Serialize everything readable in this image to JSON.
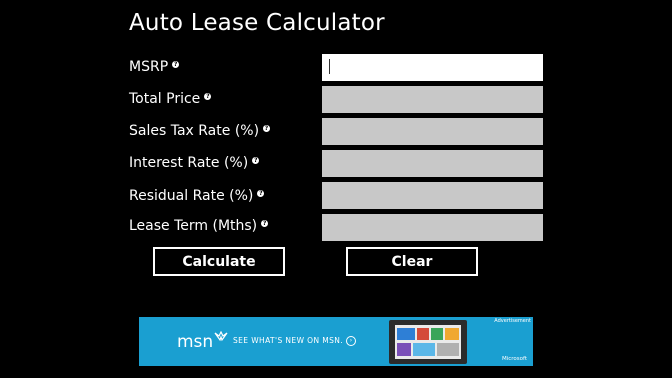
{
  "app": {
    "title": "Auto Lease Calculator"
  },
  "fields": [
    {
      "label": "MSRP",
      "value": ""
    },
    {
      "label": "Total Price",
      "value": ""
    },
    {
      "label": "Sales Tax Rate (%)",
      "value": ""
    },
    {
      "label": "Interest Rate (%)",
      "value": ""
    },
    {
      "label": "Residual Rate (%)",
      "value": ""
    },
    {
      "label": "Lease Term (Mths)",
      "value": ""
    }
  ],
  "help_glyph": "?",
  "buttons": {
    "calculate": "Calculate",
    "clear": "Clear"
  },
  "ad": {
    "logo": "msn",
    "text": "SEE WHAT'S NEW ON MSN.",
    "tag": "Advertisement",
    "brand": "Microsoft",
    "background": "#1a9fd1"
  },
  "colors": {
    "background": "#000000",
    "field_inactive": "#c8c8c8",
    "field_active": "#ffffff"
  }
}
